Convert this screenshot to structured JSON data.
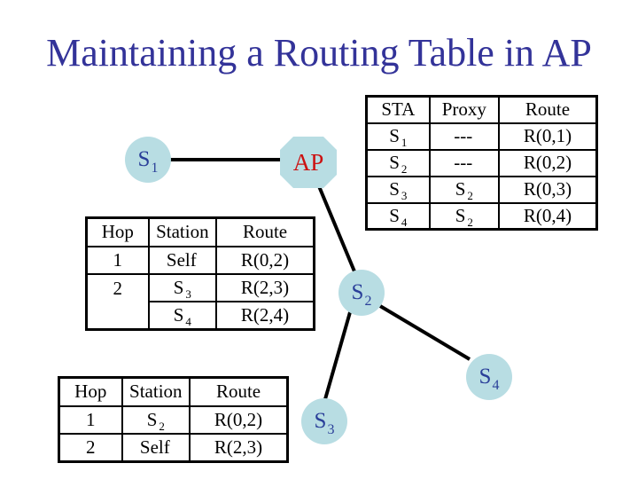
{
  "title": "Maintaining a Routing Table in AP",
  "colors": {
    "title": "#333399",
    "node_fill": "#b8dde3",
    "node_text": "#2a3f99",
    "ap_text": "#cc1111",
    "link": "#000000"
  },
  "nodes": {
    "s1": {
      "label": "S",
      "sub": "1",
      "shape": "circle"
    },
    "ap": {
      "label": "AP",
      "shape": "octagon"
    },
    "s2": {
      "label": "S",
      "sub": "2",
      "shape": "circle"
    },
    "s3": {
      "label": "S",
      "sub": "3",
      "shape": "circle"
    },
    "s4": {
      "label": "S",
      "sub": "4",
      "shape": "circle"
    }
  },
  "links": [
    {
      "from": "S1",
      "to": "AP"
    },
    {
      "from": "AP",
      "to": "S2"
    },
    {
      "from": "S2",
      "to": "S3"
    },
    {
      "from": "S2",
      "to": "S4"
    }
  ],
  "ap_table": {
    "headers": [
      "STA",
      "Proxy",
      "Route"
    ],
    "rows": [
      {
        "sta": "S",
        "sta_sub": "1",
        "proxy": "---",
        "proxy_sub": "",
        "route": "R(0,1)"
      },
      {
        "sta": "S",
        "sta_sub": "2",
        "proxy": "---",
        "proxy_sub": "",
        "route": "R(0,2)"
      },
      {
        "sta": "S",
        "sta_sub": "3",
        "proxy": "S",
        "proxy_sub": "2",
        "route": "R(0,3)"
      },
      {
        "sta": "S",
        "sta_sub": "4",
        "proxy": "S",
        "proxy_sub": "2",
        "route": "R(0,4)"
      }
    ]
  },
  "s2_table": {
    "headers": [
      "Hop",
      "Station",
      "Route"
    ],
    "rows": [
      {
        "hop": "1",
        "station": "Self",
        "station_sub": "",
        "route": "R(0,2)"
      },
      {
        "hop": "2",
        "station": "S",
        "station_sub": "3",
        "route": "R(2,3)"
      },
      {
        "hop": "",
        "station": "S",
        "station_sub": "4",
        "route": "R(2,4)"
      }
    ]
  },
  "s3_table": {
    "headers": [
      "Hop",
      "Station",
      "Route"
    ],
    "rows": [
      {
        "hop": "1",
        "station": "S",
        "station_sub": "2",
        "route": "R(0,2)"
      },
      {
        "hop": "2",
        "station": "Self",
        "station_sub": "",
        "route": "R(2,3)"
      }
    ]
  }
}
